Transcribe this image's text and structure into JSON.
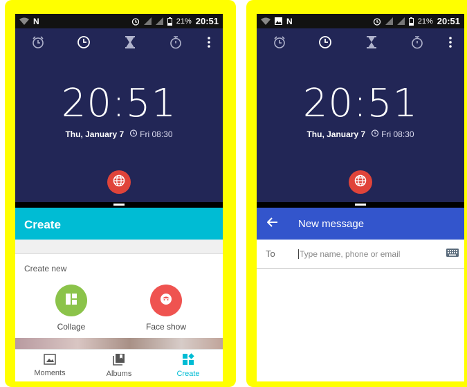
{
  "status": {
    "battery": "21%",
    "time": "20:51"
  },
  "clock": {
    "time": "20:51",
    "date": "Thu, January 7",
    "next_alarm": "Fri 08:30",
    "tabs": [
      "alarm-icon",
      "clock-icon",
      "timer-icon",
      "stopwatch-icon"
    ]
  },
  "gallery": {
    "header_title": "Create",
    "create_new_label": "Create new",
    "options": [
      {
        "label": "Collage",
        "color": "#8bc34a",
        "icon": "collage-icon"
      },
      {
        "label": "Face show",
        "color": "#ef5350",
        "icon": "face-show-icon"
      }
    ],
    "nav": [
      {
        "label": "Moments",
        "icon": "moments-icon",
        "active": false
      },
      {
        "label": "Albums",
        "icon": "albums-icon",
        "active": false
      },
      {
        "label": "Create",
        "icon": "create-icon",
        "active": true
      }
    ],
    "accent": "#00bcd4"
  },
  "messaging": {
    "header_title": "New message",
    "to_label": "To",
    "recipient_placeholder": "Type name, phone or email",
    "accent": "#3355cc"
  }
}
